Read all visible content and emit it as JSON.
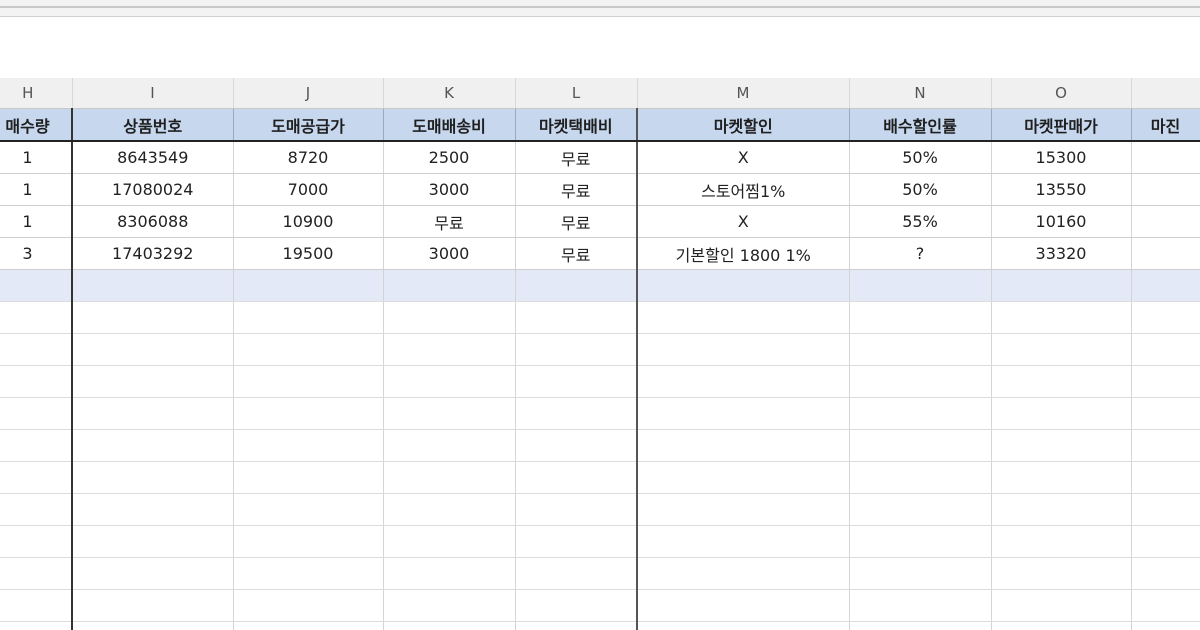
{
  "columns": [
    "H",
    "I",
    "J",
    "K",
    "L",
    "M",
    "N",
    "O",
    ""
  ],
  "headers": [
    "매수량",
    "상품번호",
    "도매공급가",
    "도매배송비",
    "마켓택배비",
    "마켓할인",
    "배수할인률",
    "마켓판매가",
    "마진"
  ],
  "rows": [
    [
      "1",
      "8643549",
      "8720",
      "2500",
      "무료",
      "X",
      "50%",
      "15300",
      ""
    ],
    [
      "1",
      "17080024",
      "7000",
      "3000",
      "무료",
      "스토어찜1%",
      "50%",
      "13550",
      ""
    ],
    [
      "1",
      "8306088",
      "10900",
      "무료",
      "무료",
      "X",
      "55%",
      "10160",
      ""
    ],
    [
      "3",
      "17403292",
      "19500",
      "3000",
      "무료",
      "기본할인 1800 1%",
      "?",
      "33320",
      ""
    ]
  ]
}
